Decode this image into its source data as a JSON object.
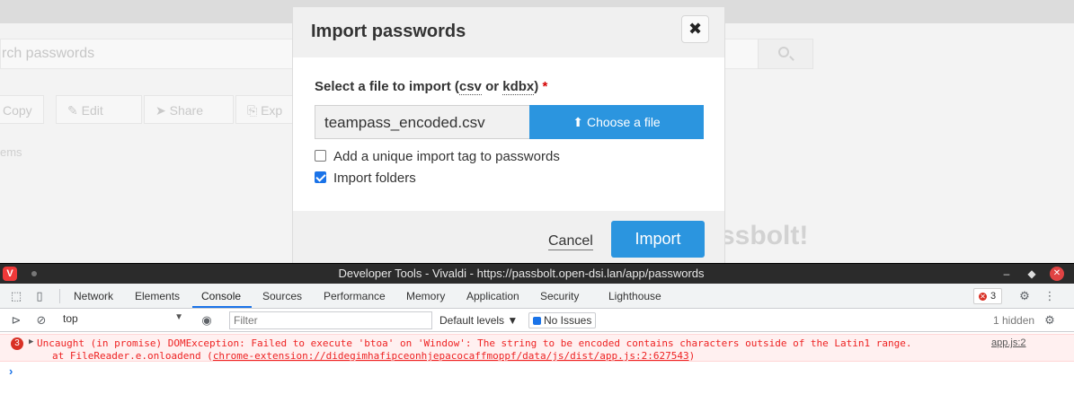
{
  "background": {
    "search_placeholder": "rch passwords",
    "actions": [
      "Copy",
      "Edit",
      "Share",
      "Exp"
    ],
    "items_label": "ems",
    "welcome_fragment": "ssbolt!"
  },
  "modal": {
    "title": "Import passwords",
    "close_glyph": "✖",
    "field_label_prefix": "Select a file to import ",
    "field_label_abbr1": "csv",
    "field_label_or": " or ",
    "field_label_abbr2": "kdbx",
    "field_label_suffix": ")",
    "field_label_open": "(",
    "required_mark": "*",
    "file_name": "teampass_encoded.csv",
    "choose_file_label": "Choose a file",
    "checkbox_tag_label": "Add a unique import tag to passwords",
    "checkbox_tag_checked": false,
    "checkbox_folders_label": "Import folders",
    "checkbox_folders_checked": true,
    "cancel_label": "Cancel",
    "import_label": "Import"
  },
  "devtools": {
    "window_title": "Developer Tools - Vivaldi - https://passbolt.open-dsi.lan/app/passwords",
    "tabs": [
      "Network",
      "Elements",
      "Console",
      "Sources",
      "Performance",
      "Memory",
      "Application",
      "Security",
      "Lighthouse"
    ],
    "active_tab": "Console",
    "error_count": "3",
    "context": "top",
    "filter_placeholder": "Filter",
    "levels_label": "Default levels ▼",
    "issues_label": "No Issues",
    "hidden_label": "1 hidden",
    "error_badge_num": "3",
    "error_line1": "Uncaught (in promise) DOMException: Failed to execute 'btoa' on 'Window': The string to be encoded contains characters outside of the Latin1 range.",
    "error_line2_prefix": "at FileReader.e.onloadend (",
    "error_line2_link": "chrome-extension://didegimhafipceonhjepacocaffmoppf/data/js/dist/app.js:2:627543",
    "error_line2_suffix": ")",
    "error_source": "app.js:2",
    "prompt_glyph": "›"
  }
}
